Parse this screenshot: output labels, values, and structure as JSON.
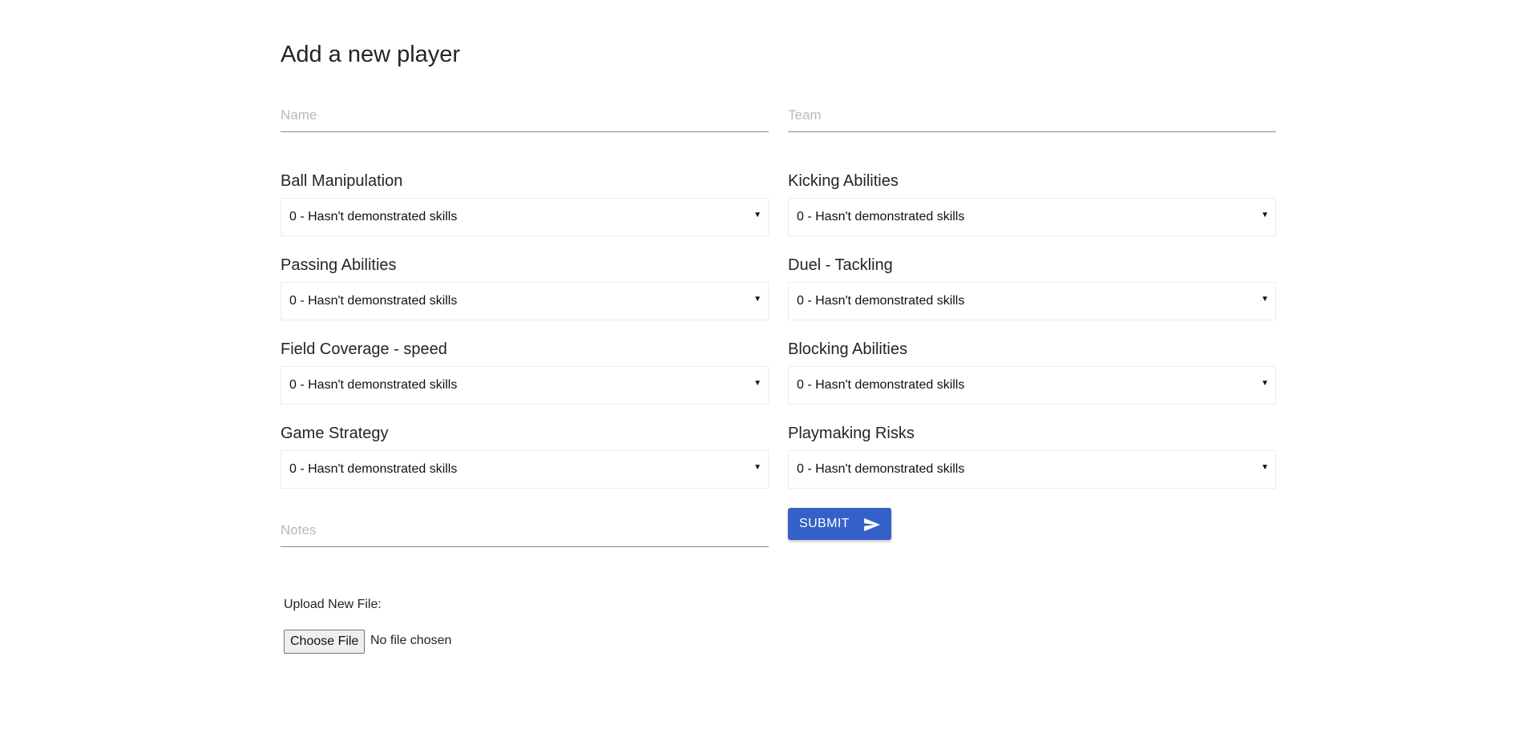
{
  "page": {
    "title": "Add a new player"
  },
  "fields": {
    "name": {
      "placeholder": "Name",
      "value": ""
    },
    "team": {
      "placeholder": "Team",
      "value": ""
    },
    "notes": {
      "placeholder": "Notes",
      "value": ""
    }
  },
  "skills": [
    {
      "label": "Ball Manipulation",
      "selected": "0 - Hasn't demonstrated skills"
    },
    {
      "label": "Kicking Abilities",
      "selected": "0 - Hasn't demonstrated skills"
    },
    {
      "label": "Passing Abilities",
      "selected": "0 - Hasn't demonstrated skills"
    },
    {
      "label": "Duel - Tackling",
      "selected": "0 - Hasn't demonstrated skills"
    },
    {
      "label": "Field Coverage - speed",
      "selected": "0 - Hasn't demonstrated skills"
    },
    {
      "label": "Blocking Abilities",
      "selected": "0 - Hasn't demonstrated skills"
    },
    {
      "label": "Game Strategy",
      "selected": "0 - Hasn't demonstrated skills"
    },
    {
      "label": "Playmaking Risks",
      "selected": "0 - Hasn't demonstrated skills"
    }
  ],
  "submit": {
    "label": "SUBMIT",
    "icon": "send-icon",
    "color": "#3460c8"
  },
  "upload": {
    "label": "Upload New File:",
    "button_label": "Choose File",
    "status": "No file chosen"
  }
}
